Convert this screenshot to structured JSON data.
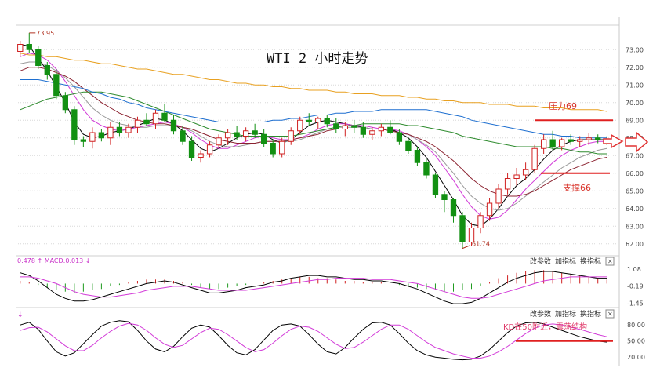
{
  "chart_data": {
    "type": "candlestick",
    "title": "WTI 2 小时走势",
    "price_axis": {
      "ticks": [
        "73.00",
        "72.00",
        "71.00",
        "70.00",
        "69.00",
        "68.00",
        "67.00",
        "66.00",
        "65.00",
        "64.00",
        "63.00",
        "62.00"
      ],
      "ylim": [
        61.5,
        74.3
      ]
    },
    "high_label": "73.95",
    "low_label": "61.74",
    "annotations": {
      "resistance": "压力69",
      "support": "支撑66",
      "kd_note": "KD在50附近，震荡结构"
    },
    "levels": {
      "resistance": 69,
      "support": 66,
      "kd_line": 50
    },
    "candles": [
      [
        72.9,
        73.5,
        72.6,
        73.3
      ],
      [
        73.3,
        73.95,
        72.8,
        73.0
      ],
      [
        73.0,
        73.2,
        71.9,
        72.1
      ],
      [
        72.1,
        72.3,
        71.3,
        71.6
      ],
      [
        71.6,
        71.9,
        70.2,
        70.4
      ],
      [
        70.4,
        70.6,
        69.4,
        69.6
      ],
      [
        69.6,
        69.8,
        67.6,
        67.9
      ],
      [
        67.9,
        68.1,
        67.5,
        67.8
      ],
      [
        67.8,
        68.6,
        67.4,
        68.3
      ],
      [
        68.3,
        68.5,
        67.8,
        68.0
      ],
      [
        68.0,
        68.9,
        67.6,
        68.6
      ],
      [
        68.6,
        68.9,
        68.1,
        68.3
      ],
      [
        68.3,
        68.8,
        68.0,
        68.6
      ],
      [
        68.6,
        69.2,
        68.3,
        69.0
      ],
      [
        69.0,
        69.4,
        68.7,
        68.8
      ],
      [
        68.8,
        69.6,
        68.5,
        69.4
      ],
      [
        69.4,
        69.9,
        68.9,
        69.0
      ],
      [
        69.0,
        69.3,
        68.2,
        68.4
      ],
      [
        68.4,
        68.7,
        67.6,
        67.8
      ],
      [
        67.8,
        68.1,
        66.7,
        66.9
      ],
      [
        66.9,
        67.3,
        66.6,
        67.1
      ],
      [
        67.1,
        67.8,
        66.9,
        67.6
      ],
      [
        67.6,
        68.2,
        67.4,
        68.0
      ],
      [
        68.0,
        68.5,
        67.6,
        68.3
      ],
      [
        68.3,
        68.7,
        67.9,
        68.1
      ],
      [
        68.1,
        68.6,
        67.8,
        68.4
      ],
      [
        68.4,
        68.8,
        68.0,
        68.2
      ],
      [
        68.2,
        68.5,
        67.5,
        67.7
      ],
      [
        67.7,
        67.9,
        66.9,
        67.1
      ],
      [
        67.1,
        68.0,
        66.9,
        67.8
      ],
      [
        67.8,
        68.6,
        67.6,
        68.4
      ],
      [
        68.4,
        69.2,
        68.2,
        69.0
      ],
      [
        69.0,
        69.4,
        68.7,
        68.9
      ],
      [
        68.9,
        69.2,
        68.5,
        69.1
      ],
      [
        69.1,
        69.3,
        68.6,
        68.8
      ],
      [
        68.8,
        69.1,
        68.3,
        68.5
      ],
      [
        68.5,
        68.9,
        68.1,
        68.7
      ],
      [
        68.7,
        69.0,
        68.3,
        68.6
      ],
      [
        68.6,
        68.9,
        68.0,
        68.2
      ],
      [
        68.2,
        68.6,
        67.9,
        68.4
      ],
      [
        68.4,
        68.8,
        68.1,
        68.6
      ],
      [
        68.6,
        69.0,
        68.2,
        68.3
      ],
      [
        68.3,
        68.5,
        67.6,
        67.8
      ],
      [
        67.8,
        68.0,
        67.1,
        67.3
      ],
      [
        67.3,
        67.5,
        66.4,
        66.6
      ],
      [
        66.6,
        66.8,
        65.7,
        65.9
      ],
      [
        65.9,
        66.0,
        64.6,
        64.8
      ],
      [
        64.8,
        65.0,
        63.8,
        64.5
      ],
      [
        64.5,
        64.6,
        63.2,
        63.6
      ],
      [
        63.6,
        63.8,
        61.74,
        62.1
      ],
      [
        62.1,
        63.2,
        61.9,
        62.9
      ],
      [
        62.9,
        63.8,
        62.6,
        63.6
      ],
      [
        63.6,
        64.6,
        63.3,
        64.3
      ],
      [
        64.3,
        65.4,
        64.0,
        65.1
      ],
      [
        65.1,
        66.0,
        64.8,
        65.7
      ],
      [
        65.7,
        66.3,
        65.3,
        65.9
      ],
      [
        65.9,
        66.6,
        65.6,
        66.2
      ],
      [
        66.2,
        67.6,
        66.0,
        67.4
      ],
      [
        67.4,
        68.2,
        67.1,
        67.9
      ],
      [
        67.9,
        68.4,
        67.3,
        67.5
      ],
      [
        67.5,
        68.0,
        67.3,
        67.9
      ],
      [
        67.9,
        68.2,
        67.6,
        67.8
      ],
      [
        67.8,
        68.1,
        67.5,
        67.9
      ],
      [
        67.9,
        68.3,
        67.6,
        68.0
      ],
      [
        68.0,
        68.2,
        67.7,
        67.9
      ],
      [
        67.9,
        68.1,
        67.6,
        67.8
      ]
    ],
    "moving_averages": [
      {
        "color": "#000000",
        "values": [
          73.3,
          73.2,
          72.5,
          71.8,
          70.9,
          70.0,
          68.9,
          68.2,
          68.0,
          68.1,
          68.3,
          68.4,
          68.5,
          68.7,
          68.9,
          69.1,
          69.0,
          68.8,
          68.4,
          67.9,
          67.4,
          67.2,
          67.4,
          67.7,
          68.0,
          68.2,
          68.3,
          68.2,
          67.9,
          67.7,
          67.9,
          68.3,
          68.7,
          68.9,
          69.0,
          68.9,
          68.8,
          68.7,
          68.6,
          68.5,
          68.5,
          68.5,
          68.3,
          68.0,
          67.5,
          66.9,
          66.1,
          65.3,
          64.5,
          63.6,
          63.1,
          63.0,
          63.4,
          64.0,
          64.7,
          65.3,
          65.7,
          66.2,
          66.8,
          67.3,
          67.6,
          67.8,
          67.9,
          67.9,
          67.9,
          67.9
        ]
      },
      {
        "color": "#d23ad8",
        "values": [
          72.6,
          72.8,
          72.7,
          72.4,
          71.9,
          71.2,
          70.4,
          69.6,
          69.0,
          68.7,
          68.5,
          68.4,
          68.5,
          68.6,
          68.7,
          68.8,
          68.9,
          68.8,
          68.6,
          68.3,
          67.9,
          67.6,
          67.4,
          67.4,
          67.6,
          67.8,
          68.0,
          68.1,
          68.0,
          67.9,
          67.9,
          68.0,
          68.2,
          68.5,
          68.7,
          68.8,
          68.8,
          68.7,
          68.7,
          68.6,
          68.5,
          68.5,
          68.4,
          68.2,
          67.9,
          67.5,
          67.0,
          66.3,
          65.6,
          64.8,
          64.1,
          63.6,
          63.4,
          63.5,
          63.9,
          64.5,
          65.1,
          65.6,
          66.1,
          66.6,
          67.0,
          67.3,
          67.5,
          67.7,
          67.8,
          67.8
        ]
      },
      {
        "color": "#999999",
        "values": [
          72.2,
          72.3,
          72.3,
          72.1,
          71.8,
          71.4,
          70.9,
          70.3,
          69.7,
          69.3,
          69.0,
          68.8,
          68.7,
          68.6,
          68.6,
          68.7,
          68.7,
          68.7,
          68.6,
          68.4,
          68.1,
          67.8,
          67.6,
          67.5,
          67.5,
          67.6,
          67.7,
          67.8,
          67.8,
          67.8,
          67.8,
          67.9,
          68.1,
          68.3,
          68.5,
          68.6,
          68.6,
          68.6,
          68.6,
          68.5,
          68.5,
          68.4,
          68.3,
          68.2,
          67.9,
          67.6,
          67.2,
          66.6,
          66.0,
          65.3,
          64.7,
          64.3,
          64.0,
          63.9,
          64.0,
          64.3,
          64.7,
          65.1,
          65.5,
          65.9,
          66.3,
          66.6,
          66.9,
          67.1,
          67.3,
          67.4
        ]
      },
      {
        "color": "#8b2230",
        "values": [
          71.8,
          72.0,
          72.0,
          71.9,
          71.7,
          71.5,
          71.2,
          70.8,
          70.4,
          70.0,
          69.7,
          69.4,
          69.2,
          69.0,
          68.9,
          68.8,
          68.8,
          68.7,
          68.6,
          68.5,
          68.3,
          68.1,
          67.9,
          67.8,
          67.7,
          67.7,
          67.7,
          67.8,
          67.8,
          67.8,
          67.9,
          68.0,
          68.1,
          68.2,
          68.4,
          68.5,
          68.5,
          68.5,
          68.5,
          68.5,
          68.5,
          68.4,
          68.3,
          68.2,
          68.0,
          67.8,
          67.5,
          67.1,
          66.7,
          66.2,
          65.7,
          65.3,
          65.0,
          64.8,
          64.7,
          64.7,
          64.8,
          65.0,
          65.3,
          65.6,
          65.9,
          66.2,
          66.4,
          66.6,
          66.8,
          66.9
        ]
      },
      {
        "color": "#2e8b2e",
        "values": [
          69.6,
          69.8,
          70.0,
          70.2,
          70.3,
          70.4,
          70.5,
          70.6,
          70.6,
          70.6,
          70.5,
          70.4,
          70.3,
          70.1,
          69.9,
          69.7,
          69.5,
          69.3,
          69.1,
          68.9,
          68.7,
          68.5,
          68.4,
          68.3,
          68.2,
          68.1,
          68.1,
          68.1,
          68.1,
          68.1,
          68.1,
          68.2,
          68.3,
          68.4,
          68.5,
          68.6,
          68.7,
          68.7,
          68.8,
          68.8,
          68.8,
          68.8,
          68.8,
          68.7,
          68.7,
          68.6,
          68.5,
          68.4,
          68.3,
          68.1,
          68.0,
          67.9,
          67.8,
          67.7,
          67.6,
          67.5,
          67.5,
          67.5,
          67.5,
          67.4,
          67.4,
          67.3,
          67.2,
          67.2,
          67.1,
          67.1
        ]
      },
      {
        "color": "#1e6fd0",
        "values": [
          71.3,
          71.3,
          71.3,
          71.2,
          71.1,
          71.0,
          70.9,
          70.8,
          70.6,
          70.5,
          70.3,
          70.2,
          70.0,
          69.9,
          69.7,
          69.6,
          69.5,
          69.4,
          69.3,
          69.2,
          69.1,
          69.0,
          68.9,
          68.9,
          68.9,
          68.9,
          68.9,
          68.9,
          69.0,
          69.0,
          69.1,
          69.1,
          69.2,
          69.3,
          69.3,
          69.4,
          69.4,
          69.5,
          69.5,
          69.5,
          69.6,
          69.6,
          69.6,
          69.6,
          69.6,
          69.6,
          69.5,
          69.4,
          69.3,
          69.2,
          69.0,
          68.9,
          68.8,
          68.7,
          68.6,
          68.5,
          68.4,
          68.3,
          68.2,
          68.2,
          68.1,
          68.1,
          68.0,
          68.0,
          68.0,
          68.0
        ]
      },
      {
        "color": "#e8a020",
        "values": [
          72.8,
          72.7,
          72.7,
          72.6,
          72.6,
          72.5,
          72.4,
          72.4,
          72.3,
          72.2,
          72.2,
          72.1,
          72.0,
          71.9,
          71.9,
          71.8,
          71.7,
          71.6,
          71.6,
          71.5,
          71.4,
          71.3,
          71.3,
          71.2,
          71.1,
          71.1,
          71.0,
          71.0,
          70.9,
          70.9,
          70.8,
          70.8,
          70.7,
          70.7,
          70.7,
          70.6,
          70.6,
          70.5,
          70.5,
          70.5,
          70.4,
          70.4,
          70.4,
          70.3,
          70.3,
          70.2,
          70.2,
          70.1,
          70.1,
          70.0,
          70.0,
          70.0,
          69.9,
          69.9,
          69.9,
          69.8,
          69.8,
          69.8,
          69.7,
          69.7,
          69.7,
          69.6,
          69.6,
          69.6,
          69.6,
          69.5
        ]
      }
    ],
    "macd": {
      "header": "0.478 ↑ MACD:0.013 ↓",
      "ticks": [
        "1.08",
        "-0.19",
        "-1.45"
      ],
      "ylim": [
        -1.55,
        1.25
      ],
      "histogram": [
        0.2,
        0.1,
        -0.1,
        -0.3,
        -0.5,
        -0.6,
        -0.7,
        -0.6,
        -0.5,
        -0.4,
        -0.2,
        -0.1,
        0.1,
        0.2,
        0.3,
        0.3,
        0.3,
        0.2,
        0.1,
        -0.1,
        -0.3,
        -0.4,
        -0.4,
        -0.3,
        -0.2,
        -0.1,
        0.0,
        0.1,
        0.2,
        0.3,
        0.4,
        0.5,
        0.5,
        0.4,
        0.4,
        0.3,
        0.2,
        0.2,
        0.1,
        0.1,
        0.1,
        0.0,
        -0.1,
        -0.2,
        -0.3,
        -0.4,
        -0.5,
        -0.6,
        -0.6,
        -0.5,
        -0.4,
        -0.2,
        0.1,
        0.4,
        0.6,
        0.8,
        0.9,
        1.0,
        1.0,
        0.9,
        0.8,
        0.7,
        0.6,
        0.5,
        0.4,
        0.3
      ],
      "dif": [
        0.8,
        0.6,
        0.2,
        -0.3,
        -0.8,
        -1.1,
        -1.3,
        -1.3,
        -1.2,
        -1.0,
        -0.8,
        -0.6,
        -0.4,
        -0.2,
        0.0,
        0.1,
        0.2,
        0.1,
        -0.1,
        -0.3,
        -0.5,
        -0.7,
        -0.7,
        -0.6,
        -0.5,
        -0.3,
        -0.2,
        -0.1,
        0.1,
        0.2,
        0.4,
        0.5,
        0.6,
        0.6,
        0.5,
        0.5,
        0.4,
        0.3,
        0.3,
        0.2,
        0.2,
        0.1,
        0.0,
        -0.2,
        -0.4,
        -0.7,
        -1.0,
        -1.3,
        -1.5,
        -1.5,
        -1.4,
        -1.1,
        -0.7,
        -0.3,
        0.1,
        0.4,
        0.6,
        0.8,
        0.9,
        0.9,
        0.8,
        0.7,
        0.6,
        0.5,
        0.4,
        0.4
      ],
      "dea": [
        0.5,
        0.5,
        0.4,
        0.2,
        0.0,
        -0.3,
        -0.6,
        -0.8,
        -0.9,
        -1.0,
        -1.0,
        -0.9,
        -0.8,
        -0.7,
        -0.5,
        -0.4,
        -0.3,
        -0.2,
        -0.2,
        -0.2,
        -0.3,
        -0.4,
        -0.5,
        -0.5,
        -0.5,
        -0.5,
        -0.4,
        -0.3,
        -0.2,
        -0.1,
        0.0,
        0.1,
        0.2,
        0.3,
        0.3,
        0.4,
        0.4,
        0.4,
        0.4,
        0.3,
        0.3,
        0.3,
        0.2,
        0.1,
        0.0,
        -0.2,
        -0.4,
        -0.6,
        -0.8,
        -1.0,
        -1.1,
        -1.1,
        -1.0,
        -0.8,
        -0.6,
        -0.4,
        -0.2,
        0.0,
        0.2,
        0.3,
        0.4,
        0.5,
        0.5,
        0.5,
        0.5,
        0.5
      ]
    },
    "kd": {
      "ticks": [
        "80.00",
        "50.00",
        "20.00"
      ],
      "ylim": [
        10,
        95
      ],
      "k": [
        80,
        85,
        72,
        50,
        30,
        22,
        28,
        45,
        62,
        78,
        85,
        88,
        86,
        70,
        50,
        35,
        30,
        40,
        58,
        74,
        80,
        76,
        60,
        42,
        28,
        24,
        34,
        52,
        70,
        80,
        82,
        78,
        62,
        44,
        30,
        26,
        38,
        56,
        72,
        84,
        85,
        80,
        64,
        46,
        32,
        24,
        20,
        18,
        16,
        15,
        16,
        22,
        34,
        50,
        66,
        78,
        84,
        85,
        82,
        76,
        70,
        64,
        58,
        54,
        50,
        48
      ],
      "d": [
        70,
        75,
        76,
        67,
        54,
        41,
        32,
        32,
        42,
        56,
        68,
        78,
        83,
        80,
        70,
        56,
        44,
        38,
        42,
        54,
        66,
        74,
        72,
        62,
        50,
        38,
        30,
        34,
        46,
        60,
        72,
        78,
        76,
        68,
        56,
        44,
        36,
        38,
        48,
        60,
        72,
        80,
        80,
        72,
        60,
        48,
        38,
        32,
        26,
        22,
        18,
        18,
        22,
        30,
        40,
        52,
        64,
        74,
        80,
        82,
        80,
        76,
        72,
        67,
        62,
        58
      ]
    },
    "toolbar": [
      "改参数",
      "加指标",
      "换指标"
    ],
    "close_glyph": "✕"
  }
}
